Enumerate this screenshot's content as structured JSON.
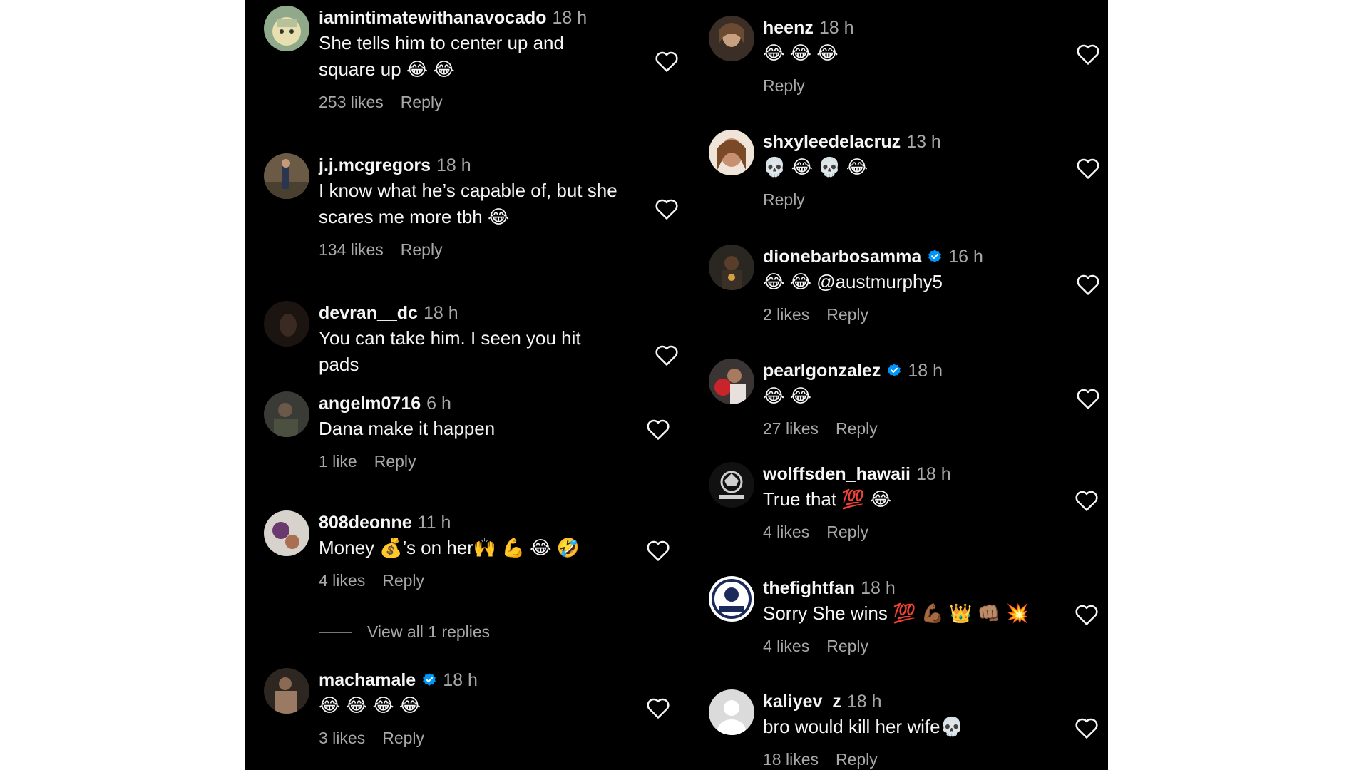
{
  "left_comments": [
    {
      "username": "iamintimatewithanavocado",
      "time": "18 h",
      "text": "She tells him to center up and square up 😂 😂",
      "likes": "253 likes",
      "reply": "Reply"
    },
    {
      "username": "j.j.mcgregors",
      "time": "18 h",
      "text": "I know what he’s capable of, but she scares me more tbh 😂",
      "likes": "134 likes",
      "reply": "Reply"
    },
    {
      "username": "devran__dc",
      "time": "18 h",
      "text": "You can take him. I seen you hit pads",
      "likes": "",
      "reply": ""
    },
    {
      "username": "angelm0716",
      "time": "6 h",
      "text": "Dana make it happen",
      "likes": "1 like",
      "reply": "Reply"
    },
    {
      "username": "808deonne",
      "time": "11 h",
      "text": "Money 💰’s on her🙌 💪 😂 🤣",
      "likes": "4 likes",
      "reply": "Reply",
      "view_replies": "View all 1 replies"
    },
    {
      "username": "machamale",
      "time": "18 h",
      "verified": true,
      "text": "😂 😂 😂 😂",
      "likes": "3 likes",
      "reply": "Reply"
    }
  ],
  "right_comments": [
    {
      "username": "heenz",
      "time": "18 h",
      "text": "😂 😂 😂",
      "likes": "",
      "reply": "Reply"
    },
    {
      "username": "shxyleedelacruz",
      "time": "13 h",
      "text": "💀 😂 💀 😂",
      "likes": "",
      "reply": "Reply"
    },
    {
      "username": "dionebarbosamma",
      "time": "16 h",
      "verified": true,
      "text": "😂 😂 @austmurphy5",
      "likes": "2 likes",
      "reply": "Reply"
    },
    {
      "username": "pearlgonzalez",
      "time": "18 h",
      "verified": true,
      "text": "😂 😂",
      "likes": "27 likes",
      "reply": "Reply"
    },
    {
      "username": "wolffsden_hawaii",
      "time": "18 h",
      "text": "True that 💯 😂",
      "likes": "4 likes",
      "reply": "Reply"
    },
    {
      "username": "thefightfan",
      "time": "18 h",
      "text": "Sorry She wins 💯 💪🏾 👑 👊🏽 💥",
      "likes": "4 likes",
      "reply": "Reply"
    },
    {
      "username": "kaliyev_z",
      "time": "18 h",
      "text": "bro would kill her wife💀",
      "likes": "18 likes",
      "reply": "Reply"
    }
  ],
  "colors": {
    "background": "#000000",
    "text": "#f5f5f5",
    "muted": "#a8a8a8",
    "verified": "#0095f6"
  },
  "icons": {
    "like": "heart-outline-icon",
    "verified": "verified-badge-icon"
  }
}
